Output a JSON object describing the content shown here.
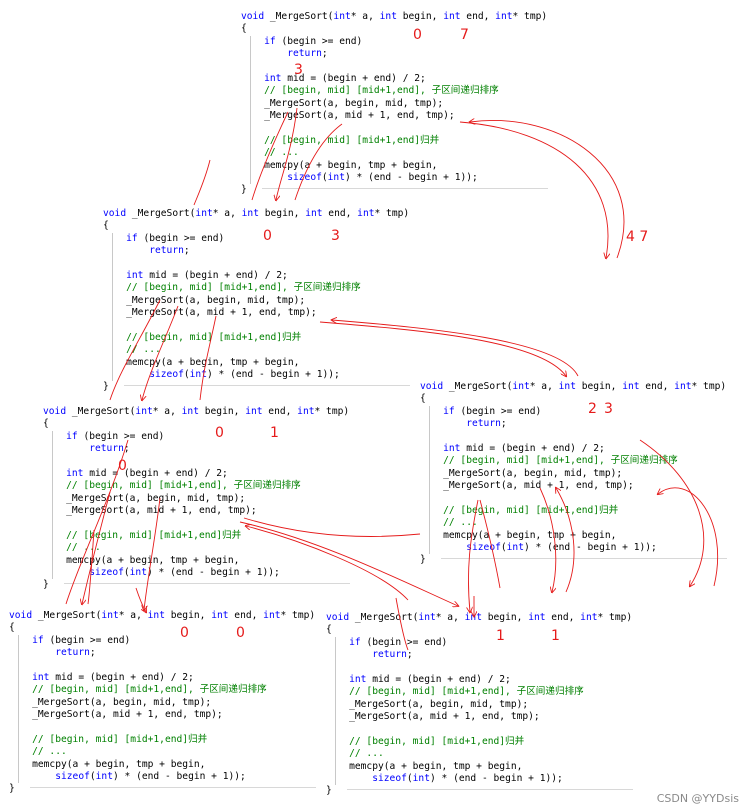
{
  "code_lines": [
    {
      "kind": "sig",
      "text": "void _MergeSort(int* a, int begin, int end, int* tmp)"
    },
    {
      "kind": "brace",
      "text": "{"
    },
    {
      "kind": "if",
      "text": "    if (begin >= end)"
    },
    {
      "kind": "ret",
      "text": "        return;"
    },
    {
      "kind": "blank",
      "text": ""
    },
    {
      "kind": "decl",
      "text": "    int mid = (begin + end) / 2;"
    },
    {
      "kind": "comment",
      "text": "    // [begin, mid] [mid+1,end], 子区间递归排序"
    },
    {
      "kind": "call",
      "text": "    _MergeSort(a, begin, mid, tmp);"
    },
    {
      "kind": "call",
      "text": "    _MergeSort(a, mid + 1, end, tmp);"
    },
    {
      "kind": "blank",
      "text": ""
    },
    {
      "kind": "comment",
      "text": "    // [begin, mid] [mid+1,end]归并"
    },
    {
      "kind": "comment",
      "text": "    // ..."
    },
    {
      "kind": "call",
      "text": "    memcpy(a + begin, tmp + begin,"
    },
    {
      "kind": "sizeof",
      "text": "        sizeof(int) * (end - begin + 1));"
    },
    {
      "kind": "brace",
      "text": "}"
    }
  ],
  "frames": [
    {
      "id": "frame-0-7",
      "begin_label": "0",
      "end_label": "7",
      "return_note": "3"
    },
    {
      "id": "frame-0-3",
      "begin_label": "0",
      "end_label": "3"
    },
    {
      "id": "frame-0-1",
      "begin_label": "0",
      "end_label": "1",
      "return_note": "0"
    },
    {
      "id": "frame-2-3",
      "begin_label": "2",
      "end_label": "3"
    },
    {
      "id": "frame-0-0",
      "begin_label": "0",
      "end_label": "0"
    },
    {
      "id": "frame-1-1",
      "begin_label": "1",
      "end_label": "1"
    }
  ],
  "annotations": {
    "right_range": "4 7"
  },
  "colors": {
    "keyword": "#0000ff",
    "comment": "#008000",
    "annotation": "#e51a1a"
  },
  "watermark": "CSDN @YYDsis"
}
